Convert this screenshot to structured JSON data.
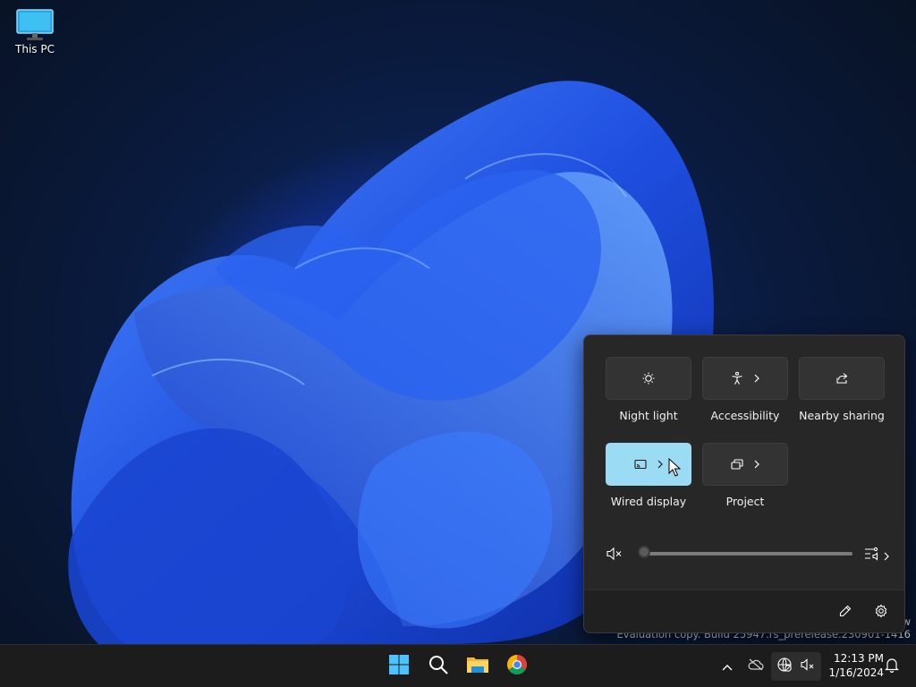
{
  "desktop": {
    "icons": [
      {
        "label": "This PC",
        "icon": "this-pc-icon"
      }
    ]
  },
  "watermark": {
    "line1": "w",
    "line2": "Evaluation copy. Build 25947.rs_prerelease.230901-1416"
  },
  "quick_settings": {
    "tiles": [
      {
        "label": "Night light",
        "icon": "night-light-icon",
        "active": false,
        "has_chevron": false
      },
      {
        "label": "Accessibility",
        "icon": "accessibility-icon",
        "active": false,
        "has_chevron": true
      },
      {
        "label": "Nearby sharing",
        "icon": "share-icon",
        "active": false,
        "has_chevron": false
      },
      {
        "label": "Wired display",
        "icon": "cast-icon",
        "active": true,
        "has_chevron": true
      },
      {
        "label": "Project",
        "icon": "project-icon",
        "active": false,
        "has_chevron": true
      }
    ],
    "volume": {
      "muted": true,
      "level": 0
    },
    "footer": {
      "edit_icon": "pencil-icon",
      "settings_icon": "gear-icon"
    },
    "active_color": "#9bdcf4"
  },
  "taskbar": {
    "apps": [
      "windows-start-icon",
      "search-icon",
      "file-explorer-icon",
      "chrome-icon"
    ],
    "tray": [
      "chevron-up-icon",
      "cloud-offline-icon",
      "network-icon",
      "speaker-muted-icon",
      "bell-icon"
    ],
    "time": "12:13 PM",
    "date": "1/16/2024"
  }
}
